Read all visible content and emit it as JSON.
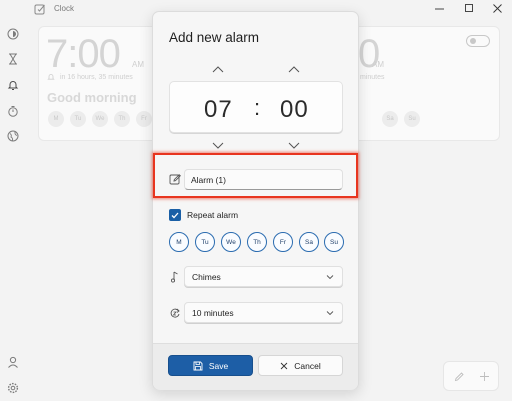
{
  "app": {
    "title": "Clock",
    "icon": "clock-app-icon"
  },
  "window_controls": [
    "minimize-icon",
    "maximize-icon",
    "close-icon"
  ],
  "nav": [
    {
      "name": "focus-sessions-icon"
    },
    {
      "name": "timer-icon"
    },
    {
      "name": "alarm-icon",
      "selected": true
    },
    {
      "name": "stopwatch-icon"
    },
    {
      "name": "world-clock-icon"
    },
    {
      "name": "account-icon"
    },
    {
      "name": "settings-icon"
    }
  ],
  "background": {
    "alarm_left": {
      "time": "7:00",
      "ampm": "AM",
      "subtitle": "in 16 hours, 35 minutes",
      "title": "Good morning",
      "days": [
        "M",
        "Tu",
        "We",
        "Th",
        "Fr",
        "Sa",
        "Su"
      ]
    },
    "alarm_right": {
      "time": "0",
      "ampm": "AM",
      "subtitle": "minutes",
      "days": [
        "Sa",
        "Su"
      ]
    }
  },
  "dialog": {
    "title": "Add new alarm",
    "hour": "07",
    "separator": ":",
    "minute": "00",
    "alarm_name": {
      "value": "Alarm (1)"
    },
    "repeat": {
      "label": "Repeat alarm",
      "checked": true
    },
    "days": [
      "M",
      "Tu",
      "We",
      "Th",
      "Fr",
      "Sa",
      "Su"
    ],
    "sound": {
      "value": "Chimes"
    },
    "snooze": {
      "value": "10 minutes"
    },
    "save_label": "Save",
    "cancel_label": "Cancel"
  },
  "colors": {
    "accent": "#1d5ea6",
    "highlight": "#e8351f"
  }
}
